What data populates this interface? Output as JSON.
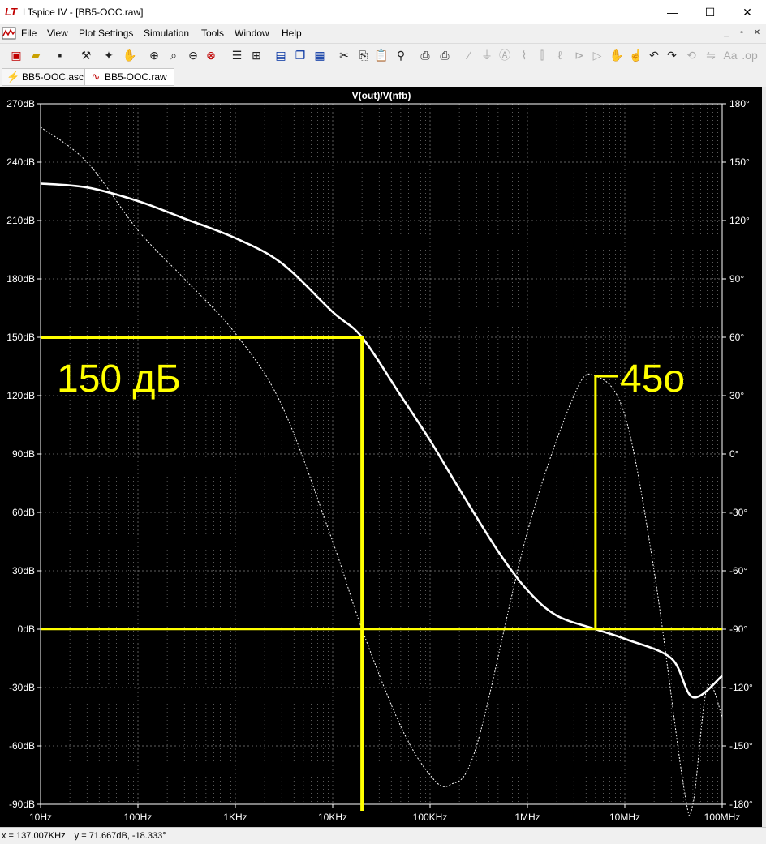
{
  "window": {
    "title": "LTspice IV - [BB5-OOC.raw]",
    "minimize": "—",
    "maximize": "☐",
    "close": "✕"
  },
  "menu": {
    "items": [
      "File",
      "View",
      "Plot Settings",
      "Simulation",
      "Tools",
      "Window",
      "Help"
    ],
    "mdi_min": "_",
    "mdi_restore": "▫",
    "mdi_close": "✕"
  },
  "toolbar": {
    "icons": [
      "new-schematic-icon",
      "open-icon",
      "save-icon",
      "control-panel-icon",
      "run-icon",
      "zoom-in-icon",
      "zoom-pan-icon",
      "zoom-out-icon",
      "zoom-cancel-icon",
      "autorange-icon",
      "tile-icon",
      "cascade-icon",
      "horizontal-icon",
      "vertical-icon",
      "cut-icon",
      "copy-icon",
      "paste-icon",
      "find-icon",
      "print-preview-icon",
      "print-icon",
      "wire-icon",
      "ground-icon",
      "label-icon",
      "resistor-icon",
      "capacitor-icon",
      "inductor-icon",
      "diode-icon",
      "component-icon",
      "move-icon",
      "drag-icon",
      "undo-icon",
      "redo-icon",
      "rotate-icon",
      "mirror-icon",
      "text-icon",
      "spice-directive-icon"
    ]
  },
  "tabs": [
    {
      "label": "BB5-OOC.asc",
      "icon": "schematic-icon",
      "active": false
    },
    {
      "label": "BB5-OOC.raw",
      "icon": "waveform-icon",
      "active": true
    }
  ],
  "plot": {
    "trace_title": "V(out)/V(nfb)",
    "left_ticks": [
      "270dB",
      "240dB",
      "210dB",
      "180dB",
      "150dB",
      "120dB",
      "90dB",
      "60dB",
      "30dB",
      "0dB",
      "-30dB",
      "-60dB",
      "-90dB"
    ],
    "right_ticks": [
      "180°",
      "150°",
      "120°",
      "90°",
      "60°",
      "30°",
      "0°",
      "-30°",
      "-60°",
      "-90°",
      "-120°",
      "-150°",
      "-180°"
    ],
    "x_ticks": [
      "10Hz",
      "100Hz",
      "1KHz",
      "10KHz",
      "100KHz",
      "1MHz",
      "10MHz",
      "100MHz"
    ],
    "annotation_gain": "150 дБ",
    "annotation_phase": "45o",
    "colors": {
      "background": "#000000",
      "trace": "#ffffff",
      "annotation": "#ffff00",
      "grid": "#808080"
    }
  },
  "chart_data": {
    "type": "line",
    "title": "V(out)/V(nfb)",
    "xscale": "log",
    "xlim": [
      10,
      100000000
    ],
    "ylim": [
      -90,
      270
    ],
    "y2lim": [
      -180,
      180
    ],
    "series": [
      {
        "style": "solid",
        "axis": "left",
        "x": [
          10,
          30,
          100,
          300,
          1000,
          3000,
          10000,
          20000,
          50000,
          100000,
          200000,
          500000,
          1000000,
          2000000,
          5000000,
          10000000,
          30000000,
          50000000,
          100000000
        ],
        "y": [
          229,
          227,
          220,
          211,
          201,
          188,
          163,
          150,
          120,
          97,
          72,
          40,
          20,
          7,
          0,
          -5,
          -15,
          -35,
          -24
        ]
      },
      {
        "style": "dotted",
        "axis": "right",
        "x": [
          10,
          30,
          100,
          300,
          1000,
          3000,
          10000,
          20000,
          50000,
          100000,
          160000,
          300000,
          1000000,
          3000000,
          5000000,
          10000000,
          20000000,
          40000000,
          50000000,
          70000000,
          100000000
        ],
        "y": [
          168,
          150,
          115,
          90,
          62,
          25,
          -45,
          -90,
          -140,
          -165,
          -170,
          -150,
          -40,
          30,
          40,
          20,
          -60,
          -170,
          -180,
          -120,
          -135
        ]
      }
    ],
    "annotations": [
      {
        "text": "150 дБ"
      },
      {
        "text": "45o"
      }
    ]
  },
  "status": {
    "x": "x = 137.007KHz",
    "y": "y = 71.667dB, -18.333°"
  }
}
